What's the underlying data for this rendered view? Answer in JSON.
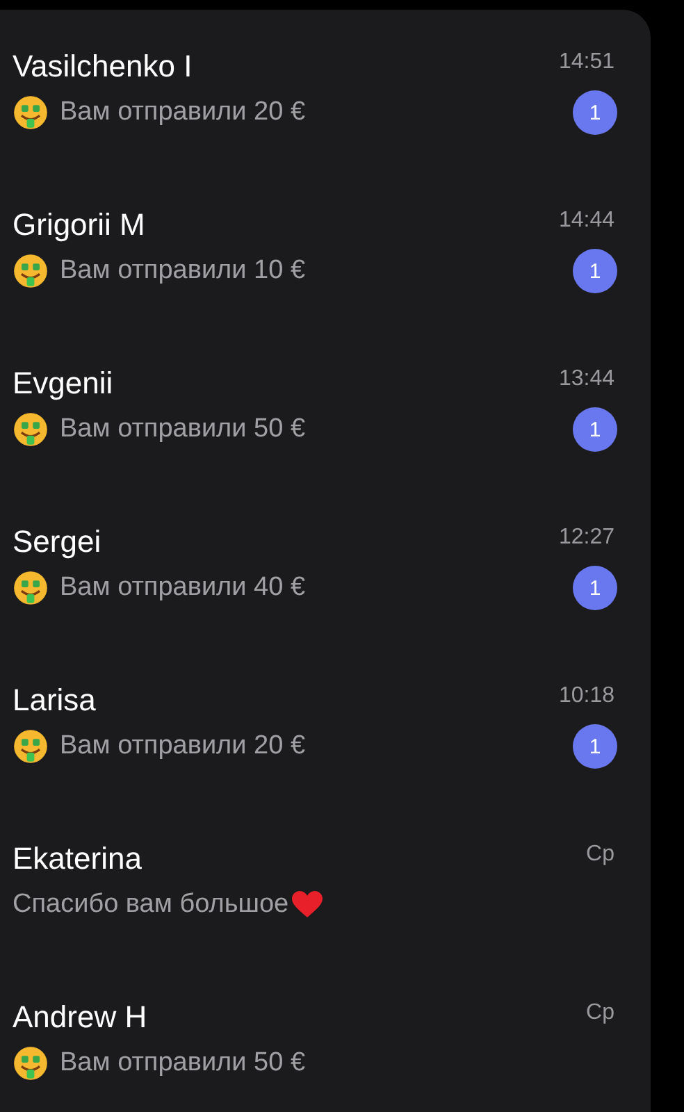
{
  "chats": [
    {
      "name": "Vasilchenko I",
      "time": "14:51",
      "kind": "payment",
      "message": "Вам отправили 20 €",
      "unread": "1"
    },
    {
      "name": "Grigorii M",
      "time": "14:44",
      "kind": "payment",
      "message": "Вам отправили 10 €",
      "unread": "1"
    },
    {
      "name": "Evgenii",
      "time": "13:44",
      "kind": "payment",
      "message": "Вам отправили 50 €",
      "unread": "1"
    },
    {
      "name": "Sergei",
      "time": "12:27",
      "kind": "payment",
      "message": "Вам отправили 40 €",
      "unread": "1"
    },
    {
      "name": "Larisa",
      "time": "10:18",
      "kind": "payment",
      "message": "Вам отправили 20 €",
      "unread": "1"
    },
    {
      "name": "Ekaterina",
      "time": "Ср",
      "kind": "love",
      "message": "Спасибо вам большое"
    },
    {
      "name": "Andrew H",
      "time": "Ср",
      "kind": "payment",
      "message": "Вам отправили 50 €"
    }
  ]
}
